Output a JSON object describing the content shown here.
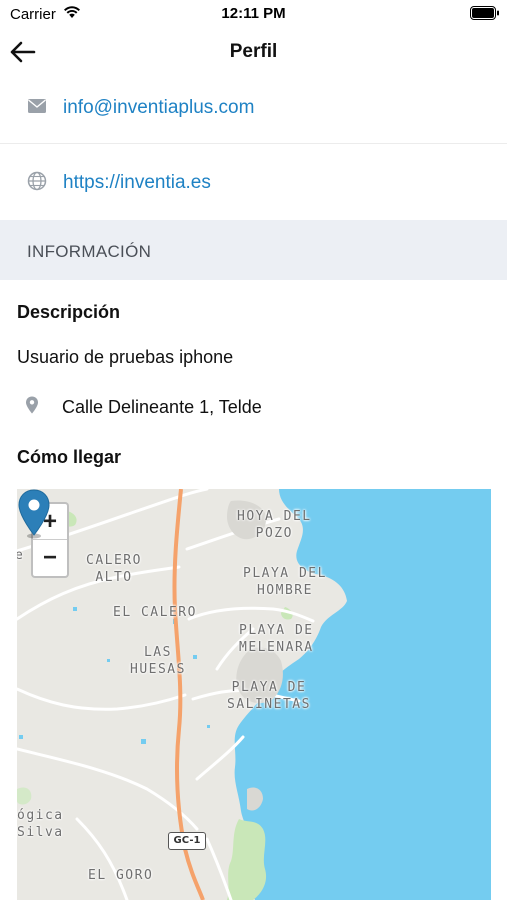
{
  "status_bar": {
    "carrier": "Carrier",
    "time": "12:11 PM",
    "icons": [
      "wifi-icon",
      "battery-icon"
    ]
  },
  "nav": {
    "title": "Perfil",
    "back_icon": "arrow-left-icon"
  },
  "contact": {
    "email": {
      "icon": "mail-icon",
      "value": "info@inventiaplus.com"
    },
    "website": {
      "icon": "globe-icon",
      "value": "https://inventia.es"
    }
  },
  "info_section": {
    "header": "INFORMACIÓN",
    "description_title": "Descripción",
    "description_text": "Usuario de pruebas iphone",
    "address_icon": "location-pin-icon",
    "address": "Calle Delineante 1, Telde",
    "directions_title": "Cómo llegar"
  },
  "map": {
    "zoom_in": "+",
    "zoom_out": "−",
    "labels": {
      "hoya_del_pozo": [
        "HOYA DEL",
        "POZO"
      ],
      "playa_del_hombre": [
        "PLAYA DEL",
        "HOMBRE"
      ],
      "calero_alto": [
        "CALERO",
        "ALTO"
      ],
      "el_calero": [
        "EL CALERO"
      ],
      "playa_de_melenara": [
        "PLAYA DE",
        "MELENARA"
      ],
      "las_huesas": [
        "LAS",
        "HUESAS"
      ],
      "playa_de_salinetas": [
        "PLAYA DE",
        "SALINETAS"
      ],
      "el_goro": [
        "EL GORO"
      ],
      "partial_left": [
        "ógica",
        "Silva"
      ],
      "partial_edge": [
        "e"
      ]
    },
    "road_sign": "GC-1",
    "colors": {
      "sea": "#74ccf0",
      "land": "#e9e8e3",
      "highway": "#f5a26b",
      "park": "#c9e7b8",
      "marker": "#2c7fb8"
    }
  }
}
